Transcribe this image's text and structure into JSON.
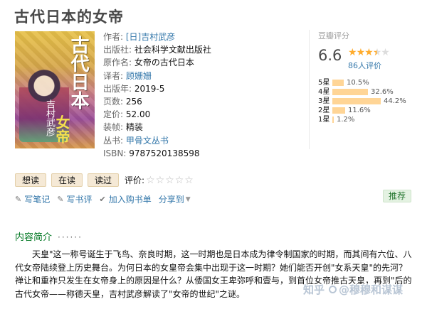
{
  "book": {
    "title": "古代日本的女帝",
    "cover": {
      "title_text": "古代日本",
      "author_text": "吉村武彦",
      "subtitle_text": "女帝"
    },
    "info": [
      {
        "label": "作者:",
        "value": "[日]吉村武彦",
        "link": true
      },
      {
        "label": "出版社:",
        "value": "社会科学文献出版社",
        "link": false
      },
      {
        "label": "原作名:",
        "value": "女帝の古代日本",
        "link": false
      },
      {
        "label": "译者:",
        "value": "顾姗姗",
        "link": true
      },
      {
        "label": "出版年:",
        "value": "2019-5",
        "link": false
      },
      {
        "label": "页数:",
        "value": "256",
        "link": false
      },
      {
        "label": "定价:",
        "value": "52.00",
        "link": false
      },
      {
        "label": "装帧:",
        "value": "精装",
        "link": false
      },
      {
        "label": "丛书:",
        "value": "甲骨文丛书",
        "link": true
      },
      {
        "label": "ISBN:",
        "value": "9787520138598",
        "link": false
      }
    ]
  },
  "rating": {
    "header": "豆瓣评分",
    "score": "6.6",
    "stars_value": 3.5,
    "people": "86人评价",
    "distribution": [
      {
        "label": "5星",
        "pct": "10.5%",
        "value": 10.5
      },
      {
        "label": "4星",
        "pct": "32.6%",
        "value": 32.6
      },
      {
        "label": "3星",
        "pct": "44.2%",
        "value": 44.2
      },
      {
        "label": "2星",
        "pct": "11.6%",
        "value": 11.6
      },
      {
        "label": "1星",
        "pct": "1.2%",
        "value": 1.2
      }
    ]
  },
  "actions": {
    "want": "想读",
    "reading": "在读",
    "read": "读过",
    "rate_label": "评价:",
    "rate_stars": "☆☆☆☆☆"
  },
  "tools": {
    "write_note": "写笔记",
    "write_review": "写书评",
    "add_cart": "加入购书单",
    "share": "分享到",
    "recommend": "推荐"
  },
  "intro": {
    "heading": "内容简介",
    "dots": "······",
    "text": "天皇\"这一称号诞生于飞鸟、奈良时期，这一时期也是日本成为律令制国家的时期，而其间有六位、八代女帝陆续登上历史舞台。为何日本的女皇帝会集中出现于这一时期？她们能否开创\"女系天皇\"的先河？禅让和重祚只发生在女帝身上的原因是什么？从倭国女王卑弥呼和壹与，到首位女帝推古天皇，再到\"后的古代女帝——称德天皇，吉村武彦解读了\"女帝的世纪\"之谜。"
  },
  "watermark": {
    "site": "知乎",
    "user": "@穆穆和谋谋"
  },
  "colors": {
    "link": "#3377aa",
    "green": "#007722",
    "star": "#ffac2d",
    "bar": "#ffd596"
  }
}
